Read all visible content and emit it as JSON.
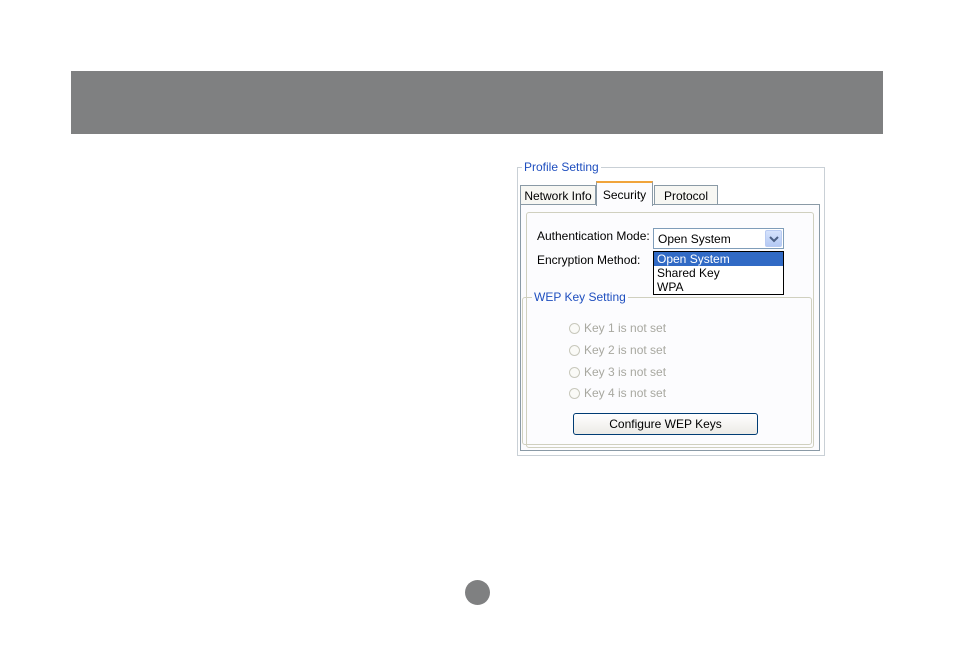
{
  "profile_setting": {
    "group_label": "Profile Setting",
    "tabs": [
      {
        "label": "Network Info"
      },
      {
        "label": "Security"
      },
      {
        "label": "Protocol"
      }
    ],
    "active_tab": "Security"
  },
  "security": {
    "authentication_mode_label": "Authentication Mode:",
    "authentication_mode_value": "Open System",
    "authentication_mode_options": [
      "Open System",
      "Shared Key",
      "WPA"
    ],
    "encryption_method_label": "Encryption Method:"
  },
  "wep": {
    "group_label": "WEP Key Setting",
    "keys": [
      {
        "label": "Key 1 is not set"
      },
      {
        "label": "Key 2 is not set"
      },
      {
        "label": "Key 3 is not set"
      },
      {
        "label": "Key 4 is not set"
      }
    ],
    "configure_button_label": "Configure WEP Keys"
  },
  "colors": {
    "header_bar": "#7f8081",
    "group_label_text": "#1f4fbf",
    "selection": "#316ac5",
    "active_tab_accent": "#f0a43c"
  }
}
